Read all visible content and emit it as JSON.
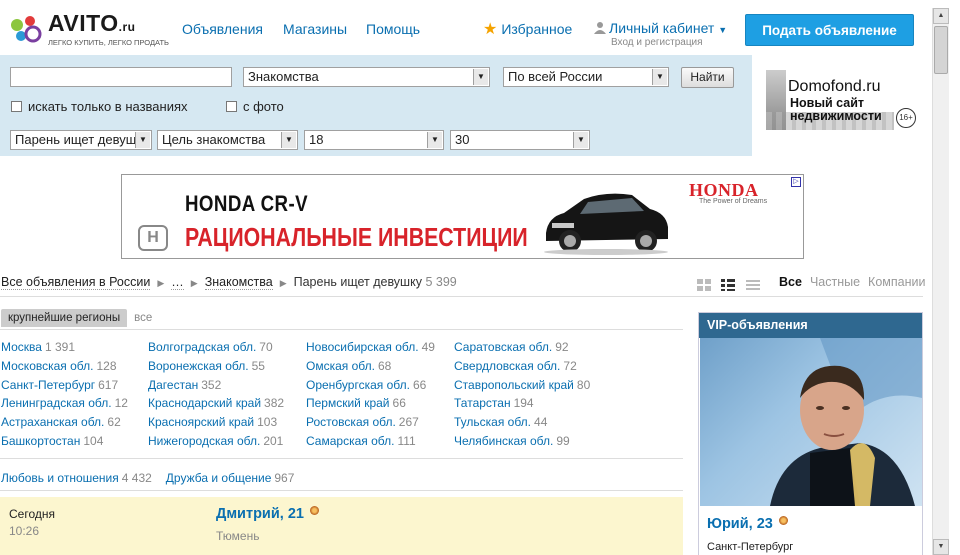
{
  "header": {
    "logo_name": "AVITO",
    "logo_suffix": ".ru",
    "logo_tagline": "ЛЕГКО КУПИТЬ, ЛЕГКО ПРОДАТЬ",
    "nav": [
      "Объявления",
      "Магазины",
      "Помощь"
    ],
    "favorites": "Избранное",
    "cabinet": "Личный кабинет",
    "cabinet_sub": "Вход и регистрация",
    "post_button": "Подать объявление"
  },
  "search": {
    "query_value": "",
    "category": "Знакомства",
    "location": "По всей России",
    "find_button": "Найти",
    "only_titles": "искать только в названиях",
    "with_photo": "с фото",
    "who": "Парень ищет девушку",
    "goal": "Цель знакомства",
    "age_from": "18",
    "age_to": "30"
  },
  "ads": {
    "domofond_title": "Domofond.ru",
    "domofond_text1": "Новый сайт",
    "domofond_text2": "недвижимости",
    "domofond_age": "16+",
    "honda_model": "HONDA CR-V",
    "honda_slogan": "РАЦИОНАЛЬНЫЕ ИНВЕСТИЦИИ",
    "honda_brand": "HONDA",
    "honda_power": "The Power of Dreams"
  },
  "breadcrumb": {
    "items": [
      "Все объявления в России",
      "…",
      "Знакомства"
    ],
    "current": "Парень ищет девушку",
    "count": "5 399"
  },
  "filters": {
    "all": "Все",
    "private": "Частные",
    "companies": "Компании"
  },
  "regions": {
    "tab_big": "крупнейшие регионы",
    "tab_all": "все",
    "columns": [
      [
        {
          "name": "Москва",
          "count": "1 391"
        },
        {
          "name": "Московская обл.",
          "count": "128"
        },
        {
          "name": "Санкт-Петербург",
          "count": "617"
        },
        {
          "name": "Ленинградская обл.",
          "count": "12"
        },
        {
          "name": "Астраханская обл.",
          "count": "62"
        },
        {
          "name": "Башкортостан",
          "count": "104"
        }
      ],
      [
        {
          "name": "Волгоградская обл.",
          "count": "70"
        },
        {
          "name": "Воронежская обл.",
          "count": "55"
        },
        {
          "name": "Дагестан",
          "count": "352"
        },
        {
          "name": "Краснодарский край",
          "count": "382"
        },
        {
          "name": "Красноярский край",
          "count": "103"
        },
        {
          "name": "Нижегородская обл.",
          "count": "201"
        }
      ],
      [
        {
          "name": "Новосибирская обл.",
          "count": "49"
        },
        {
          "name": "Омская обл.",
          "count": "68"
        },
        {
          "name": "Оренбургская обл.",
          "count": "66"
        },
        {
          "name": "Пермский край",
          "count": "66"
        },
        {
          "name": "Ростовская обл.",
          "count": "267"
        },
        {
          "name": "Самарская обл.",
          "count": "111"
        }
      ],
      [
        {
          "name": "Саратовская обл.",
          "count": "92"
        },
        {
          "name": "Свердловская обл.",
          "count": "72"
        },
        {
          "name": "Ставропольский край",
          "count": "80"
        },
        {
          "name": "Татарстан",
          "count": "194"
        },
        {
          "name": "Тульская обл.",
          "count": "44"
        },
        {
          "name": "Челябинская обл.",
          "count": "99"
        }
      ]
    ]
  },
  "categories": [
    {
      "name": "Любовь и отношения",
      "count": "4 432"
    },
    {
      "name": "Дружба и общение",
      "count": "967"
    }
  ],
  "listing": {
    "date": "Сегодня",
    "time": "10:26",
    "title": "Дмитрий, 21",
    "city": "Тюмень"
  },
  "vip": {
    "header": "VIP-объявления",
    "name": "Юрий, 23",
    "city": "Санкт-Петербург"
  },
  "colors": {
    "link": "#0a6fb0",
    "button": "#1e9fe3",
    "search_bg": "#d6e8f2",
    "vip_header": "#2f6890",
    "listing_bg": "#fcf6cf"
  }
}
